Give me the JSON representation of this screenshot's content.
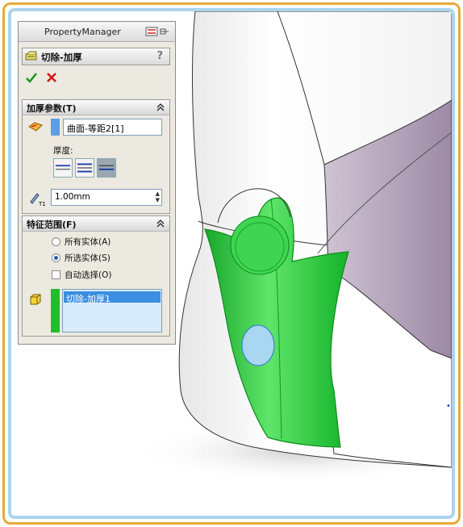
{
  "property_manager": {
    "title": "PropertyManager",
    "feature_name": "切除-加厚",
    "help": "?",
    "thicken_params": {
      "title": "加厚参数(T)",
      "surface_selection": "曲面-等距2[1]",
      "thickness_label": "厚度:",
      "thickness_value": "1.00mm",
      "thickness_symbol": "T1"
    },
    "feature_scope": {
      "title": "特征范围(F)",
      "option_all": "所有实体(A)",
      "option_selected": "所选实体(S)",
      "auto_select": "自动选择(O)",
      "selected_bodies": [
        "切除-加厚1"
      ]
    }
  },
  "colors": {
    "surface_swatch": "#5aa0e6",
    "body_swatch": "#1fbe2a",
    "part_green": "#22c43a",
    "frame_orange": "#e8a93a",
    "frame_blue": "#a9d4ee"
  }
}
